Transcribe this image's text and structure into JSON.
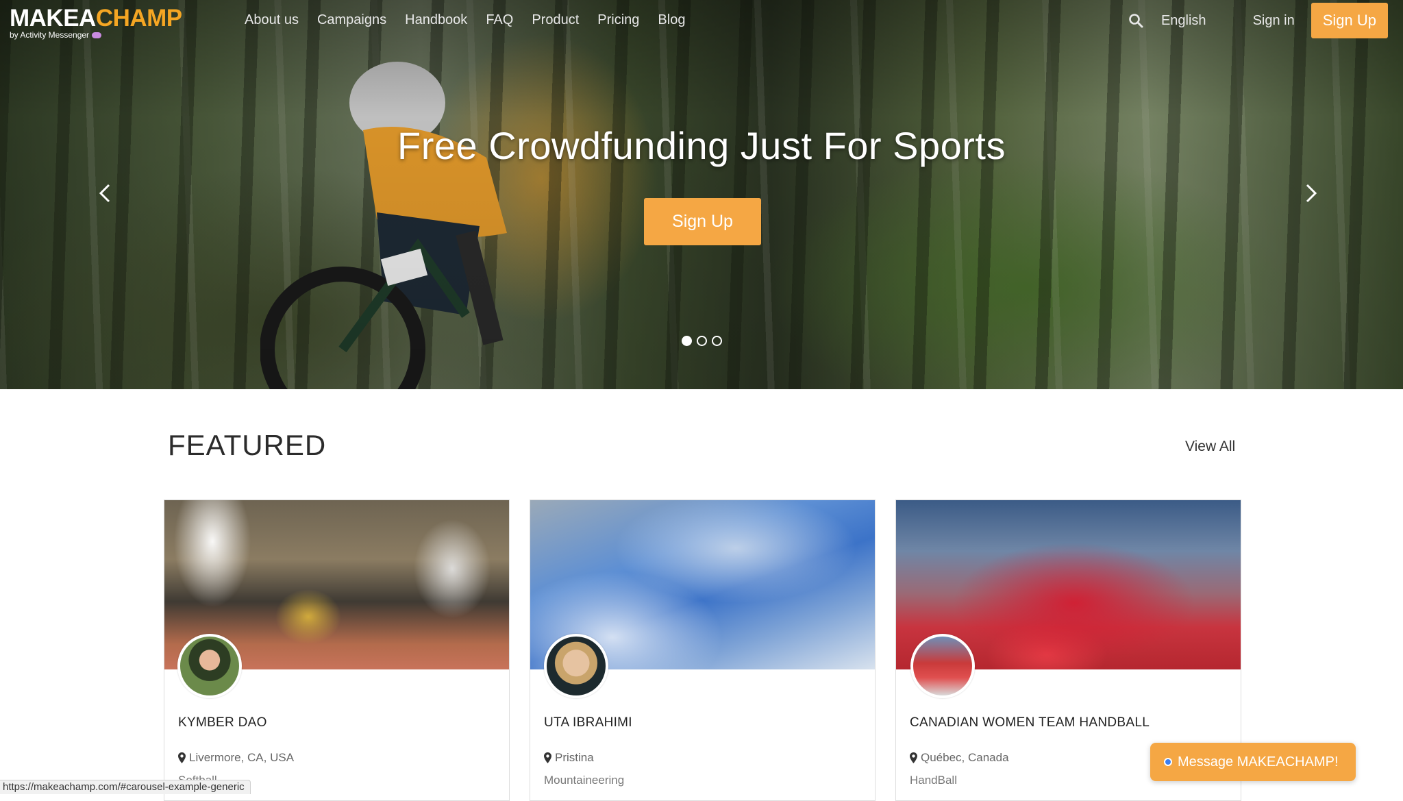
{
  "brand": {
    "logo_make": "MAKEA",
    "logo_champ": "CHAMP",
    "logo_sub": "by Activity Messenger",
    "orange": "#f5a744"
  },
  "nav": {
    "links": [
      "About us",
      "Campaigns",
      "Handbook",
      "FAQ",
      "Product",
      "Pricing",
      "Blog"
    ],
    "language": "English",
    "sign_in": "Sign in",
    "sign_up": "Sign Up",
    "search_icon": "search-icon"
  },
  "hero": {
    "title": "Free Crowdfunding Just For Sports",
    "cta": "Sign Up",
    "slides_total": 3,
    "active_slide": 1
  },
  "featured": {
    "title": "FEATURED",
    "view_all": "View All",
    "cards": [
      {
        "name": "KYMBER DAO",
        "location": "Livermore, CA, USA",
        "sport": "Softball"
      },
      {
        "name": "UTA IBRAHIMI",
        "location": "Pristina",
        "sport": "Mountaineering"
      },
      {
        "name": "CANADIAN WOMEN TEAM HANDBALL",
        "location": "Québec, Canada",
        "sport": "HandBall"
      }
    ]
  },
  "status_bar": {
    "url": "https://makeachamp.com/#carousel-example-generic"
  },
  "chat": {
    "label": "Message MAKEACHAMP!"
  }
}
